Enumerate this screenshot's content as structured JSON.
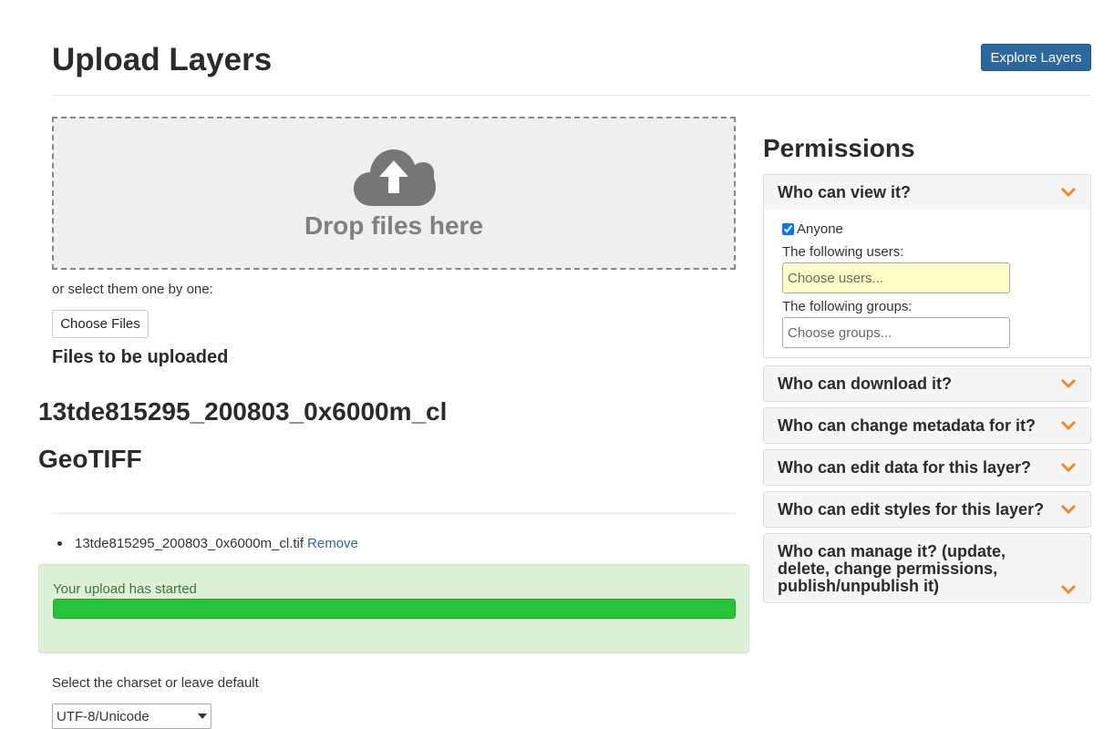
{
  "header": {
    "title": "Upload Layers",
    "explore_button": "Explore Layers"
  },
  "upload": {
    "drop_text": "Drop files here",
    "or_select": "or select them one by one:",
    "choose_files": "Choose Files",
    "files_heading": "Files to be uploaded",
    "file_title": "13tde815295_200803_0x6000m_cl",
    "file_type": "GeoTIFF",
    "file_item": "13tde815295_200803_0x6000m_cl.tif",
    "remove_label": "Remove",
    "status_text": "Your upload has started",
    "progress_percent": 100,
    "charset_label": "Select the charset or leave default",
    "charset_value": "UTF-8/Unicode"
  },
  "permissions": {
    "title": "Permissions",
    "view": {
      "label": "Who can view it?",
      "anyone_label": "Anyone",
      "anyone_checked": true,
      "users_label": "The following users:",
      "users_placeholder": "Choose users...",
      "groups_label": "The following groups:",
      "groups_placeholder": "Choose groups..."
    },
    "download": "Who can download it?",
    "change_metadata": "Who can change metadata for it?",
    "edit_data": "Who can edit data for this layer?",
    "edit_styles": "Who can edit styles for this layer?",
    "manage": "Who can manage it? (update, delete, change permissions, publish/unpublish it)"
  },
  "colors": {
    "primary": "#2c689c",
    "accent_chevron": "#f0882c",
    "progress": "#27c43b",
    "alert_bg": "#dff0d8"
  }
}
